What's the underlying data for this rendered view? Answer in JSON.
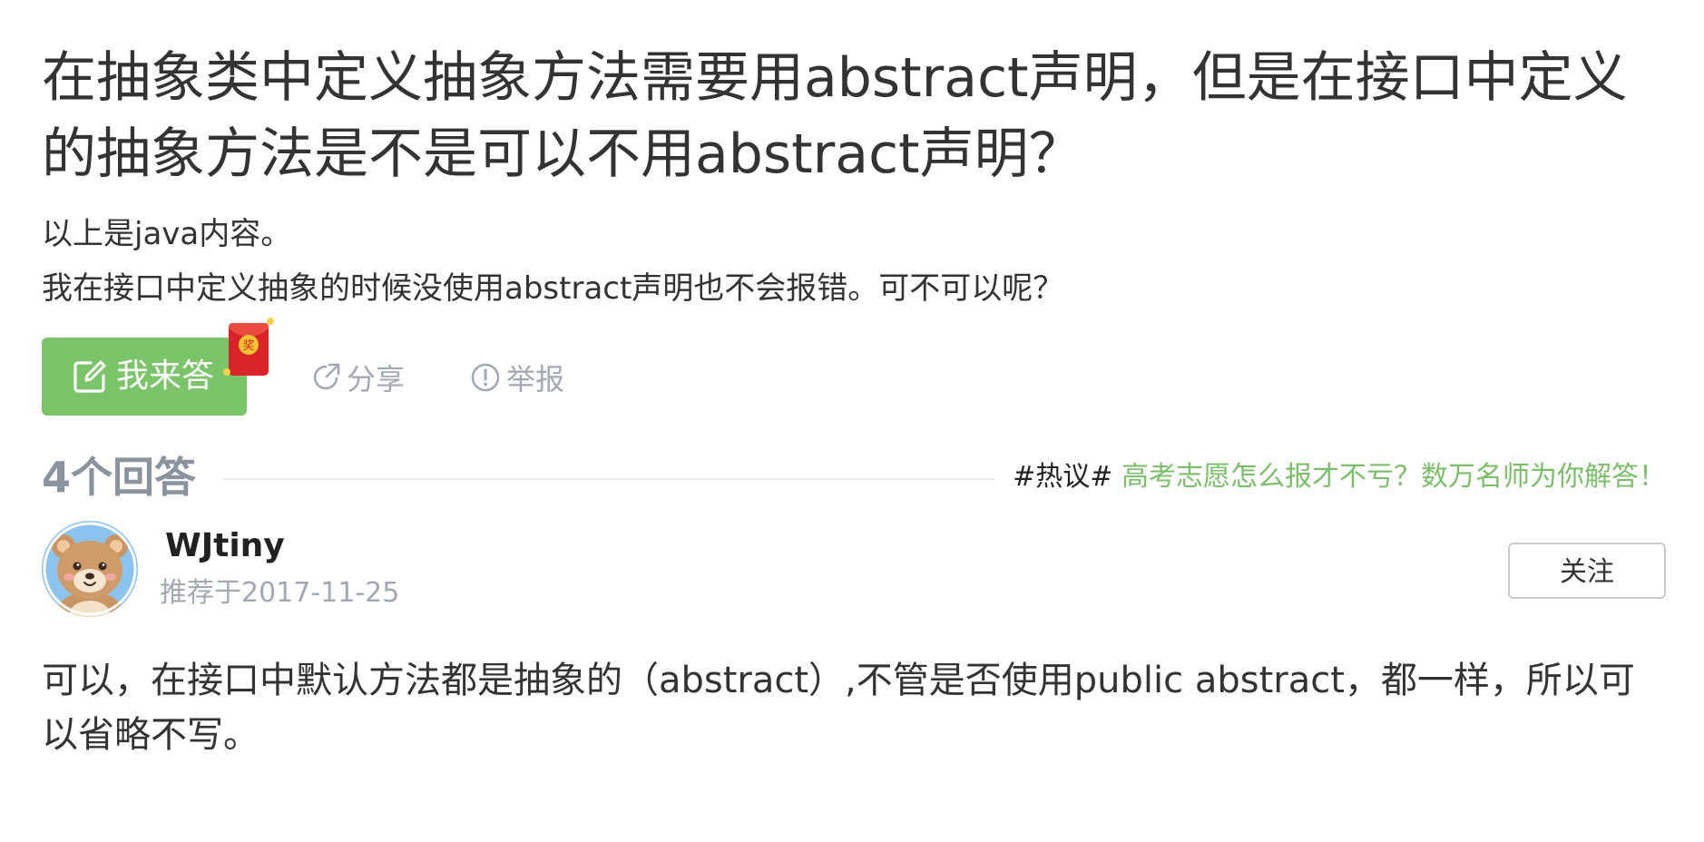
{
  "question": {
    "title": "在抽象类中定义抽象方法需要用abstract声明，但是在接口中定义的抽象方法是不是可以不用abstract声明？",
    "description_lines": [
      "以上是java内容。",
      "我在接口中定义抽象的时候没使用abstract声明也不会报错。可不可以呢？"
    ]
  },
  "actions": {
    "answer_label": "我来答",
    "redpacket_badge": "奖",
    "share_label": "分享",
    "report_label": "举报"
  },
  "answers_header": {
    "count_label": "4个回答",
    "hot_tag": "#热议#",
    "hot_link": "高考志愿怎么报才不亏？数万名师为你解答！"
  },
  "answer": {
    "author_name": "WJtiny",
    "meta": "推荐于2017-11-25",
    "follow_label": "关注",
    "content": "可以，在接口中默认方法都是抽象的（abstract）,不管是否使用public abstract，都一样，所以可以省略不写。"
  },
  "colors": {
    "accent_green": "#7bc469",
    "hot_link_green": "#7bbf6a",
    "muted_gray": "#a2a9b3",
    "redpacket_red": "#d8232a"
  },
  "icons": {
    "answer_button": "edit-icon",
    "redpacket": "red-envelope-icon",
    "share": "share-icon",
    "report": "report-icon",
    "avatar": "bear-avatar"
  }
}
